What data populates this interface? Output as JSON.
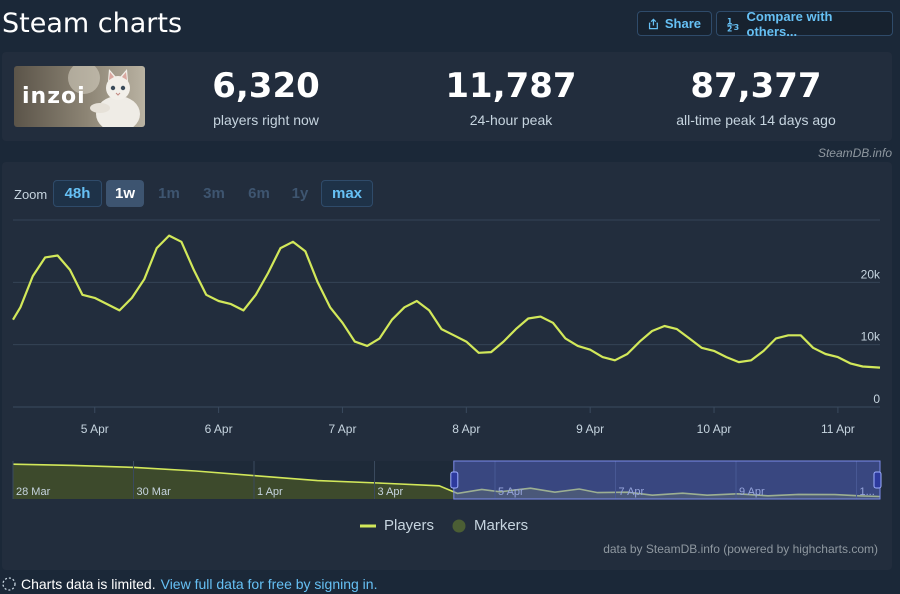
{
  "page": {
    "title": "Steam charts"
  },
  "toolbar": {
    "share_label": "Share",
    "compare_label": "Compare with others..."
  },
  "stats": {
    "logo_text": "inzoi",
    "current_value": "6,320",
    "current_label": "players right now",
    "peak24_value": "11,787",
    "peak24_label": "24-hour peak",
    "alltime_value": "87,377",
    "alltime_label": "all-time peak 14 days ago"
  },
  "source_tag": "SteamDB.info",
  "zoom": {
    "label": "Zoom",
    "options": [
      {
        "label": "48h",
        "state": "enabled"
      },
      {
        "label": "1w",
        "state": "active"
      },
      {
        "label": "1m",
        "state": "disabled"
      },
      {
        "label": "3m",
        "state": "disabled"
      },
      {
        "label": "6m",
        "state": "disabled"
      },
      {
        "label": "1y",
        "state": "disabled"
      },
      {
        "label": "max",
        "state": "enabled"
      }
    ]
  },
  "legend": {
    "players": "Players",
    "markers": "Markers"
  },
  "credit": "data by SteamDB.info (powered by highcharts.com)",
  "footer": {
    "text": "Charts data is limited.",
    "link": "View full data for free by signing in."
  },
  "colors": {
    "series": "#d2e85a",
    "background": "#1b2838",
    "card": "#222d3d",
    "accent": "#66c0f4",
    "marker": "#4b5e34"
  },
  "icons": {
    "share": "share-icon",
    "compare": "compare-icon",
    "footer": "dashed-circle-icon"
  },
  "chart_data": [
    {
      "type": "line",
      "title": "",
      "xlabel": "",
      "ylabel": "",
      "x_ticks": [
        "5 Apr",
        "6 Apr",
        "7 Apr",
        "8 Apr",
        "9 Apr",
        "10 Apr",
        "11 Apr"
      ],
      "y_ticks": [
        "0",
        "10k",
        "20k"
      ],
      "ylim": [
        0,
        30000
      ],
      "xlim": [
        -0.66,
        6.34
      ],
      "grid": true,
      "legend_position": "bottom-center",
      "series": [
        {
          "name": "Players",
          "x": [
            -0.66,
            -0.6,
            -0.5,
            -0.4,
            -0.3,
            -0.2,
            -0.1,
            0,
            0.1,
            0.2,
            0.3,
            0.4,
            0.5,
            0.6,
            0.7,
            0.8,
            0.9,
            1,
            1.1,
            1.2,
            1.3,
            1.4,
            1.5,
            1.6,
            1.7,
            1.8,
            1.9,
            2,
            2.1,
            2.2,
            2.3,
            2.4,
            2.5,
            2.6,
            2.7,
            2.8,
            2.9,
            3,
            3.1,
            3.2,
            3.3,
            3.4,
            3.5,
            3.6,
            3.7,
            3.8,
            3.9,
            4,
            4.1,
            4.2,
            4.3,
            4.4,
            4.5,
            4.6,
            4.7,
            4.8,
            4.9,
            5,
            5.1,
            5.2,
            5.3,
            5.4,
            5.5,
            5.6,
            5.7,
            5.8,
            5.9,
            6,
            6.1,
            6.2,
            6.34
          ],
          "values": [
            14000,
            16000,
            21000,
            24000,
            24300,
            22000,
            18000,
            17500,
            16500,
            15500,
            17500,
            20500,
            25500,
            27500,
            26500,
            22000,
            18000,
            17000,
            16500,
            15500,
            18000,
            21500,
            25500,
            26500,
            25000,
            20000,
            16000,
            13500,
            10500,
            9800,
            11000,
            14000,
            16000,
            17000,
            15500,
            12500,
            11500,
            10500,
            8700,
            8800,
            10500,
            12500,
            14200,
            14500,
            13500,
            11000,
            9800,
            9200,
            8000,
            7500,
            8500,
            10500,
            12200,
            13000,
            12500,
            11000,
            9500,
            9000,
            8000,
            7200,
            7500,
            9000,
            11000,
            11500,
            11500,
            9500,
            8500,
            8000,
            7000,
            6500,
            6320
          ]
        }
      ]
    },
    {
      "type": "area",
      "title": "",
      "x_ticks": [
        "28 Mar",
        "30 Mar",
        "1 Apr",
        "3 Apr",
        "5 Apr",
        "7 Apr",
        "9 Apr",
        "1..."
      ],
      "navigator_range": [
        "4 Apr",
        "11 Apr"
      ],
      "series": [
        {
          "name": "",
          "x": [
            -7.9,
            -6.9,
            -5.9,
            -4.9,
            -3.9,
            -2.9,
            -1.9,
            -0.9,
            -0.6,
            -0.2,
            0.1,
            0.6,
            1.0,
            1.4,
            1.7,
            2.2,
            2.6,
            3.1,
            3.5,
            4.0,
            4.5,
            5.0,
            5.6,
            6.0,
            6.34
          ],
          "values": [
            87000,
            84000,
            79000,
            70000,
            58000,
            46000,
            40000,
            33000,
            14000,
            24000,
            18000,
            27000,
            17000,
            25000,
            16000,
            17000,
            9500,
            14500,
            9500,
            13000,
            8000,
            11500,
            11000,
            8000,
            6320
          ]
        }
      ]
    }
  ]
}
